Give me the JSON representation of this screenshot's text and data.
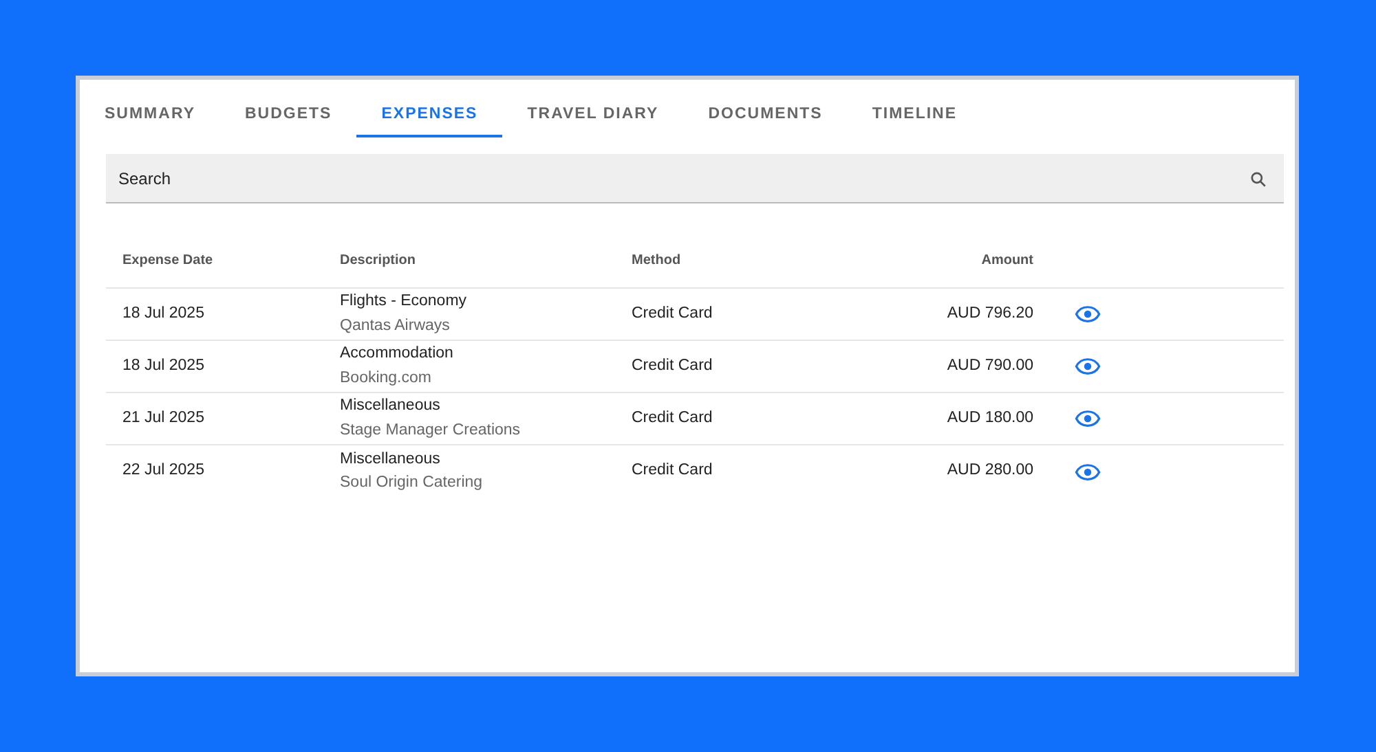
{
  "tabs": [
    {
      "label": "SUMMARY",
      "selected": false
    },
    {
      "label": "BUDGETS",
      "selected": false
    },
    {
      "label": "EXPENSES",
      "selected": true
    },
    {
      "label": "TRAVEL DIARY",
      "selected": false
    },
    {
      "label": "DOCUMENTS",
      "selected": false
    },
    {
      "label": "TIMELINE",
      "selected": false
    }
  ],
  "search": {
    "placeholder": "Search"
  },
  "table": {
    "columns": [
      "Expense Date",
      "Description",
      "Method",
      "Amount"
    ],
    "rows": [
      {
        "date": "18 Jul 2025",
        "description": "Flights - Economy",
        "vendor": "Qantas Airways",
        "method": "Credit Card",
        "amount": "AUD 796.20"
      },
      {
        "date": "18 Jul 2025",
        "description": "Accommodation",
        "vendor": "Booking.com",
        "method": "Credit Card",
        "amount": "AUD 790.00"
      },
      {
        "date": "21 Jul 2025",
        "description": "Miscellaneous",
        "vendor": "Stage Manager Creations",
        "method": "Credit Card",
        "amount": "AUD 180.00"
      },
      {
        "date": "22 Jul 2025",
        "description": "Miscellaneous",
        "vendor": "Soul Origin Catering",
        "method": "Credit Card",
        "amount": "AUD 280.00"
      }
    ]
  }
}
